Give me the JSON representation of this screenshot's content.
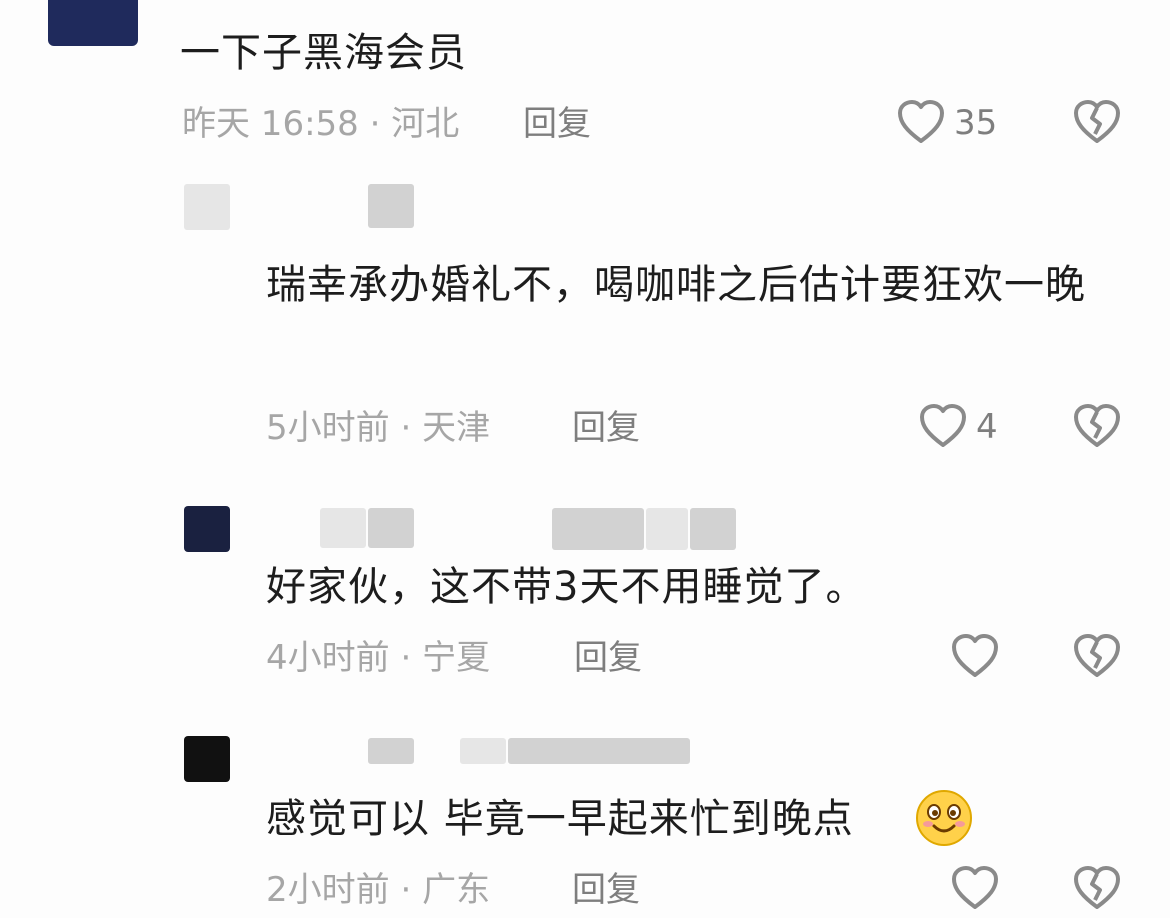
{
  "comments": [
    {
      "text": "一下子黑海会员",
      "time": "昨天 16:58",
      "location": "河北",
      "reply_label": "回复",
      "likes": "35"
    },
    {
      "text": "瑞幸承办婚礼不，喝咖啡之后估计要狂欢一晚",
      "time": "5小时前",
      "location": "天津",
      "reply_label": "回复",
      "likes": "4"
    },
    {
      "text": "好家伙，这不带3天不用睡觉了。",
      "time": "4小时前",
      "location": "宁夏",
      "reply_label": "回复",
      "likes": ""
    },
    {
      "text": "感觉可以 毕竟一早起来忙到晚点",
      "time": "2小时前",
      "location": "广东",
      "reply_label": "回复",
      "likes": ""
    }
  ],
  "separator": " · ",
  "icons": {
    "like": "heart-outline-icon",
    "dislike": "broken-heart-icon",
    "emoji": "smiling-face-emoji"
  },
  "colors": {
    "text": "#1d1d1d",
    "meta": "#a6a6a6",
    "reply": "#7e7e7e",
    "icon": "#8a8a8a",
    "avatar_top": "#1f2a5c"
  }
}
